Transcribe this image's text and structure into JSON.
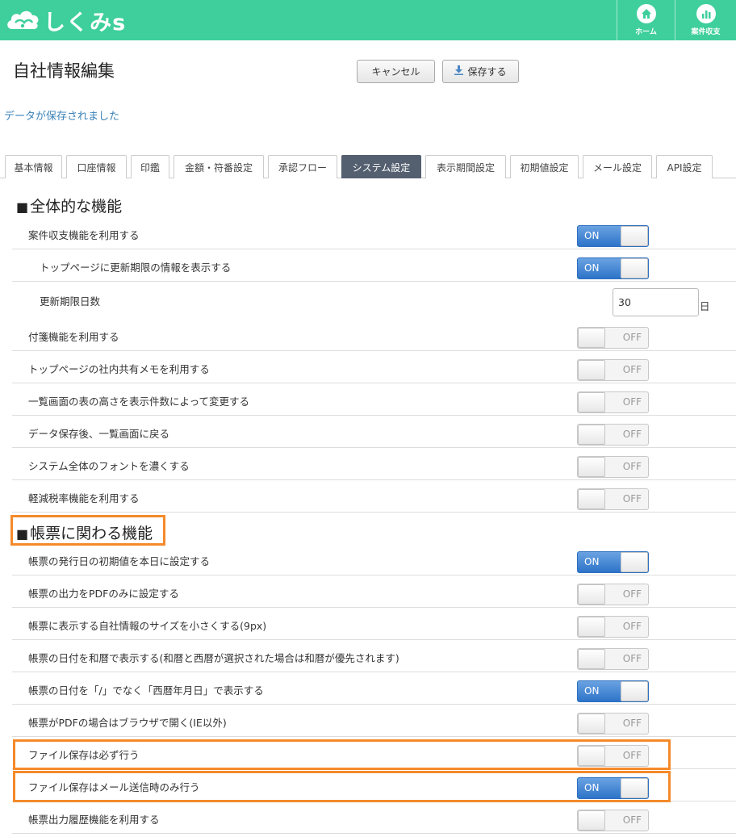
{
  "brand": {
    "name": "しくみs"
  },
  "nav": {
    "home_label": "ホーム",
    "budget_label": "案件収支"
  },
  "page": {
    "title": "自社情報編集",
    "notice": "データが保存されました"
  },
  "buttons": {
    "cancel": "キャンセル",
    "save": "保存する"
  },
  "tabs": [
    "基本情報",
    "口座情報",
    "印鑑",
    "金額・符番設定",
    "承認フロー",
    "システム設定",
    "表示期間設定",
    "初期値設定",
    "メール設定",
    "API設定"
  ],
  "active_tab": "システム設定",
  "sections": {
    "general": {
      "title": "全体的な機能",
      "rows": [
        {
          "label": "案件収支機能を利用する",
          "state": "ON"
        },
        {
          "label": "トップページに更新期限の情報を表示する",
          "state": "ON"
        },
        {
          "label": "更新期限日数",
          "value": "30",
          "unit": "日"
        },
        {
          "label": "付箋機能を利用する",
          "state": "OFF"
        },
        {
          "label": "トップページの社内共有メモを利用する",
          "state": "OFF"
        },
        {
          "label": "一覧画面の表の高さを表示件数によって変更する",
          "state": "OFF"
        },
        {
          "label": "データ保存後、一覧画面に戻る",
          "state": "OFF"
        },
        {
          "label": "システム全体のフォントを濃くする",
          "state": "OFF"
        },
        {
          "label": "軽減税率機能を利用する",
          "state": "OFF"
        }
      ]
    },
    "forms": {
      "title": "帳票に関わる機能",
      "rows": [
        {
          "label": "帳票の発行日の初期値を本日に設定する",
          "state": "ON"
        },
        {
          "label": "帳票の出力をPDFのみに設定する",
          "state": "OFF"
        },
        {
          "label": "帳票に表示する自社情報のサイズを小さくする(9px)",
          "state": "OFF"
        },
        {
          "label": "帳票の日付を和暦で表示する(和暦と西暦が選択された場合は和暦が優先されます)",
          "state": "OFF"
        },
        {
          "label": "帳票の日付を「/」でなく「西暦年月日」で表示する",
          "state": "ON"
        },
        {
          "label": "帳票がPDFの場合はブラウザで開く(IE以外)",
          "state": "OFF"
        },
        {
          "label": "ファイル保存は必ず行う",
          "state": "OFF"
        },
        {
          "label": "ファイル保存はメール送信時のみ行う",
          "state": "ON"
        },
        {
          "label": "帳票出力履歴機能を利用する",
          "state": "OFF"
        }
      ]
    }
  },
  "colors": {
    "header": "#3ecf9c",
    "highlight": "#f58a2a",
    "active_tab": "#546070",
    "toggle_on": "#2d73c9"
  }
}
